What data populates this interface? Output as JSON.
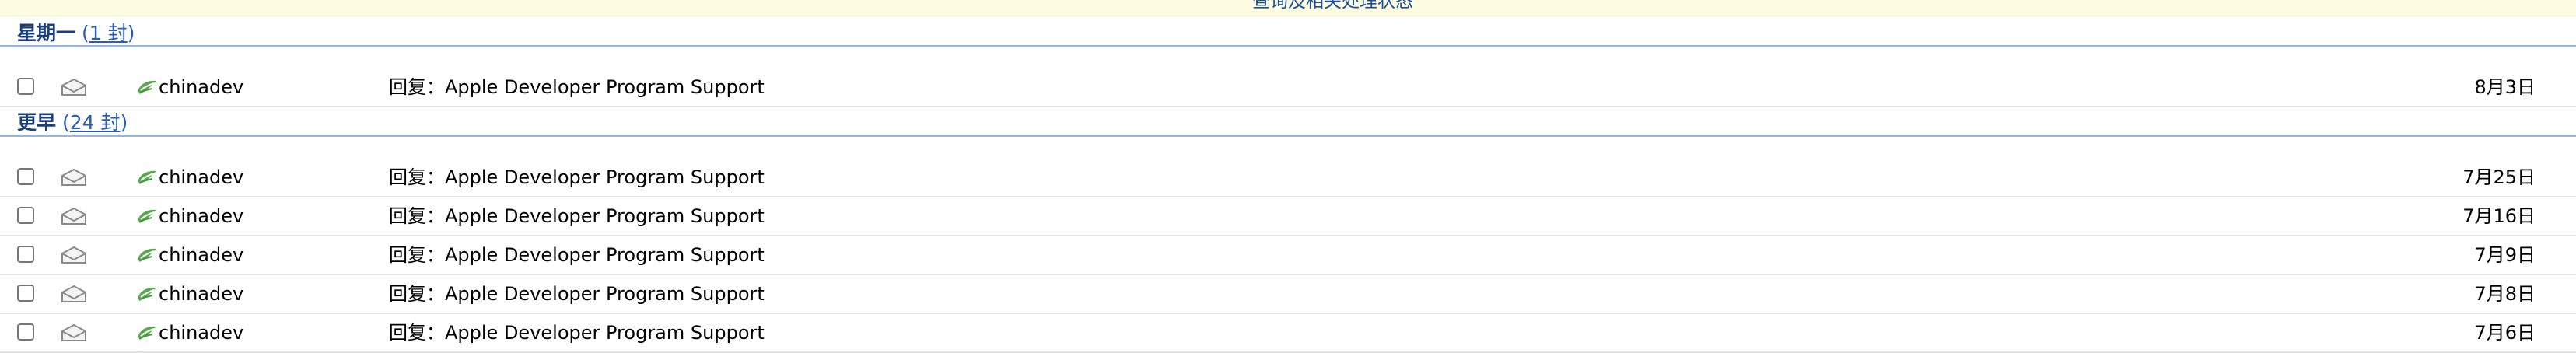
{
  "top_banner": {
    "text": "查询及相关处理状态"
  },
  "groups": [
    {
      "title": "星期一",
      "count_prefix": "(",
      "count_link": "1 封",
      "count_suffix": ")",
      "rows": [
        {
          "sender": "chinadev",
          "subject": "回复：Apple Developer Program Support",
          "date": "8月3日"
        }
      ]
    },
    {
      "title": "更早",
      "count_prefix": "(",
      "count_link": "24 封",
      "count_suffix": ")",
      "rows": [
        {
          "sender": "chinadev",
          "subject": "回复：Apple Developer Program Support",
          "date": "7月25日"
        },
        {
          "sender": "chinadev",
          "subject": "回复：Apple Developer Program Support",
          "date": "7月16日"
        },
        {
          "sender": "chinadev",
          "subject": "回复：Apple Developer Program Support",
          "date": "7月9日"
        },
        {
          "sender": "chinadev",
          "subject": "回复：Apple Developer Program Support",
          "date": "7月8日"
        },
        {
          "sender": "chinadev",
          "subject": "回复：Apple Developer Program Support",
          "date": "7月6日"
        }
      ]
    }
  ],
  "icons": {
    "read_state": "envelope-open-icon",
    "sender_badge": "leaf-icon"
  },
  "colors": {
    "group_title": "#1c3f7a",
    "link": "#2a5cb8",
    "group_divider": "#9ab6d6",
    "banner_bg": "#fdfbe0",
    "sender_badge": "#3f9a3a"
  }
}
